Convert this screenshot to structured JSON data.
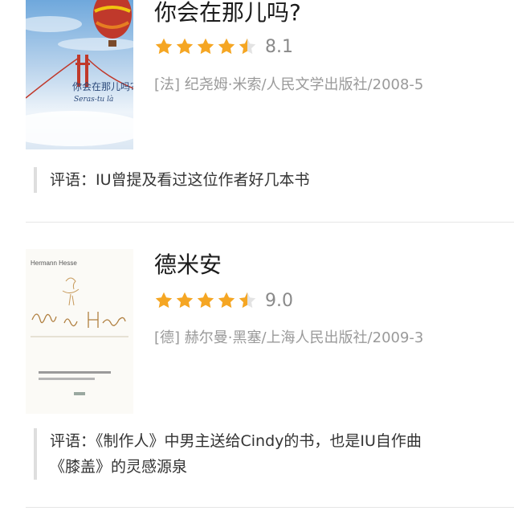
{
  "books": [
    {
      "title": "你会在那儿吗?",
      "score": "8.1",
      "rating_stars": 4.5,
      "meta": "[法] 纪尧姆·米索/人民文学出版社/2008-5",
      "comment": "评语：IU曾提及看过这位作者好几本书",
      "cover_title": "你会在那儿吗?",
      "cover_subtitle": "Seras-tu là"
    },
    {
      "title": "德米安",
      "score": "9.0",
      "rating_stars": 4.5,
      "meta": "[德] 赫尔曼·黑塞/上海人民出版社/2009-3",
      "comment_line1": "评语：《制作人》中男主送给Cindy的书，也是IU自作曲",
      "comment_line2": "《膝盖》的灵感源泉",
      "cover_author": "Hermann Hesse"
    }
  ],
  "colors": {
    "star": "#f5a623",
    "star_empty": "#e3e3e3",
    "score_text": "#8a8a8a",
    "meta_text": "#9a9a9a",
    "divider": "#e6e6e6"
  }
}
